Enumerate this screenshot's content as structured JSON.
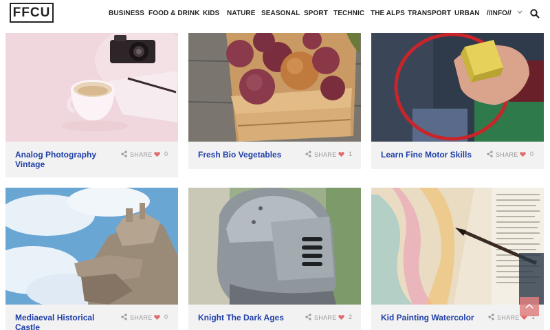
{
  "brand": {
    "logo": "FFCU"
  },
  "nav": {
    "items": [
      "BUSINESS",
      "FOOD & DRINK",
      "KIDS",
      "NATURE",
      "SEASONAL",
      "SPORT",
      "TECHNIC",
      "THE ALPS",
      "TRANSPORT",
      "URBAN",
      "//INFO//"
    ],
    "search_icon": "search-icon",
    "dropdown_icon": "chevron-down-icon"
  },
  "posts": [
    {
      "title": "Analog Photography Vintage",
      "share_label": "SHARE",
      "likes": "0",
      "image": "camera-coffee-photo"
    },
    {
      "title": "Fresh Bio Vegetables",
      "share_label": "SHARE",
      "likes": "1",
      "image": "onions-basket-photo"
    },
    {
      "title": "Learn Fine Motor Skills",
      "share_label": "SHARE",
      "likes": "0",
      "image": "toy-block-photo"
    },
    {
      "title": "Mediaeval Historical Castle",
      "share_label": "SHARE",
      "likes": "0",
      "image": "castle-ruin-photo"
    },
    {
      "title": "Knight The Dark Ages",
      "share_label": "SHARE",
      "likes": "2",
      "image": "knight-helmet-photo"
    },
    {
      "title": "Kid Painting Watercolor",
      "share_label": "SHARE",
      "likes": "1",
      "image": "watercolor-painting-photo"
    }
  ],
  "colors": {
    "title": "#1e3fa8",
    "heart": "#e26b6b",
    "footer_bg": "#f2f2f2",
    "to_top": "#e08080"
  },
  "back_to_top_icon": "chevron-up-icon"
}
